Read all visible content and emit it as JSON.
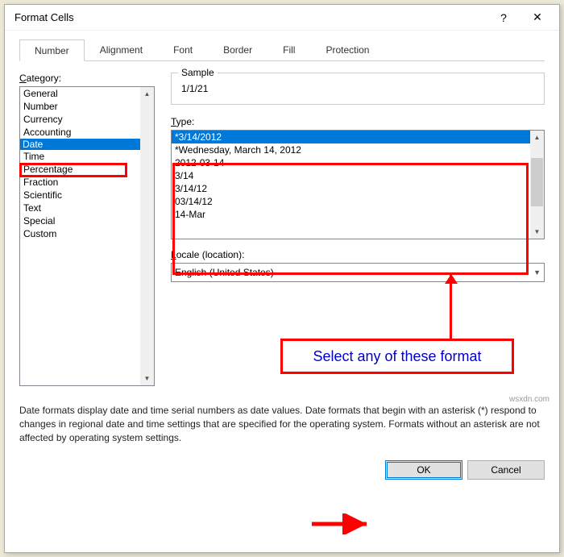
{
  "titlebar": {
    "title": "Format Cells",
    "help": "?",
    "close": "✕"
  },
  "tabs": [
    "Number",
    "Alignment",
    "Font",
    "Border",
    "Fill",
    "Protection"
  ],
  "active_tab": 0,
  "category": {
    "label": "Category:",
    "items": [
      "General",
      "Number",
      "Currency",
      "Accounting",
      "Date",
      "Time",
      "Percentage",
      "Fraction",
      "Scientific",
      "Text",
      "Special",
      "Custom"
    ],
    "selected": 4
  },
  "sample": {
    "label": "Sample",
    "value": "1/1/21"
  },
  "type": {
    "label": "Type:",
    "items": [
      "*3/14/2012",
      "*Wednesday, March 14, 2012",
      "2012-03-14",
      "3/14",
      "3/14/12",
      "03/14/12",
      "14-Mar"
    ],
    "selected": 0
  },
  "locale": {
    "label": "Locale (location):",
    "value": "English (United States)"
  },
  "description": "Date formats display date and time serial numbers as date values. Date formats that begin with an asterisk (*) respond to changes in regional date and time settings that are specified for the operating system. Formats without an asterisk are not affected by operating system settings.",
  "buttons": {
    "ok": "OK",
    "cancel": "Cancel"
  },
  "annotation": {
    "callout": "Select any of these format"
  },
  "watermark": "wsxdn.com"
}
